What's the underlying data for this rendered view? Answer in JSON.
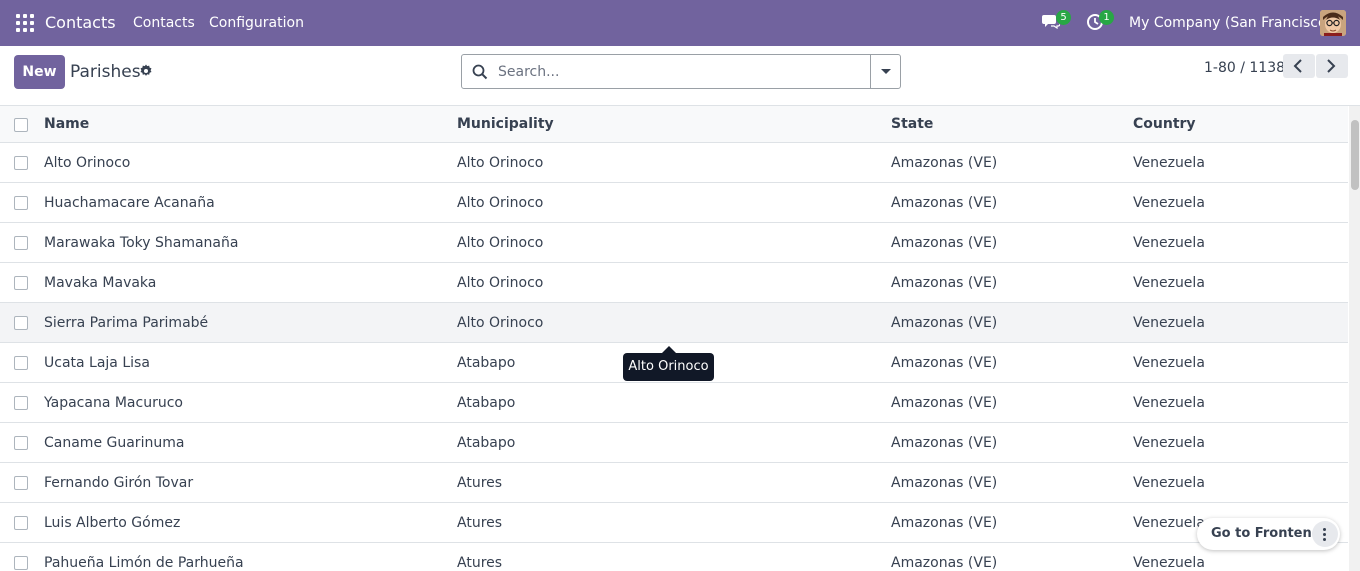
{
  "navbar": {
    "app_name": "Contacts",
    "menus": [
      "Contacts",
      "Configuration"
    ],
    "chat_badge": "5",
    "activity_badge": "1",
    "company": "My Company (San Francisco)",
    "bg_color": "#71639e"
  },
  "control": {
    "new_label": "New",
    "title": "Parishes",
    "search_placeholder": "Search...",
    "pager": "1-80 / 1138"
  },
  "table": {
    "headers": [
      "Name",
      "Municipality",
      "State",
      "Country"
    ],
    "rows": [
      [
        "Alto Orinoco",
        "Alto Orinoco",
        "Amazonas (VE)",
        "Venezuela"
      ],
      [
        "Huachamacare Acanaña",
        "Alto Orinoco",
        "Amazonas (VE)",
        "Venezuela"
      ],
      [
        "Marawaka Toky Shamanaña",
        "Alto Orinoco",
        "Amazonas (VE)",
        "Venezuela"
      ],
      [
        "Mavaka Mavaka",
        "Alto Orinoco",
        "Amazonas (VE)",
        "Venezuela"
      ],
      [
        "Sierra Parima Parimabé",
        "Alto Orinoco",
        "Amazonas (VE)",
        "Venezuela"
      ],
      [
        "Ucata Laja Lisa",
        "Atabapo",
        "Amazonas (VE)",
        "Venezuela"
      ],
      [
        "Yapacana Macuruco",
        "Atabapo",
        "Amazonas (VE)",
        "Venezuela"
      ],
      [
        "Caname Guarinuma",
        "Atabapo",
        "Amazonas (VE)",
        "Venezuela"
      ],
      [
        "Fernando Girón Tovar",
        "Atures",
        "Amazonas (VE)",
        "Venezuela"
      ],
      [
        "Luis Alberto Gómez",
        "Atures",
        "Amazonas (VE)",
        "Venezuela"
      ],
      [
        "Pahueña Limón de Parhueña",
        "Atures",
        "Amazonas (VE)",
        "Venezuela"
      ]
    ]
  },
  "tooltip": "Alto Orinoco",
  "frontend_label": "Go to Frontend"
}
